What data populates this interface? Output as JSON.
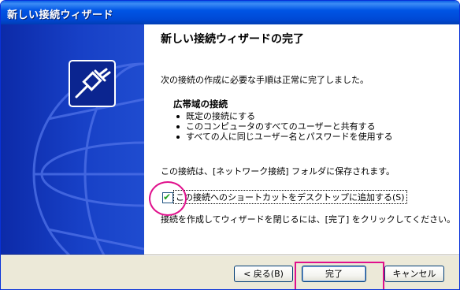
{
  "window": {
    "title": "新しい接続ウィザード"
  },
  "main": {
    "heading": "新しい接続ウィザードの完了",
    "description": "次の接続の作成に必要な手順は正常に完了しました。",
    "summary": {
      "title": "広帯域の接続",
      "items": [
        "既定の接続にする",
        "このコンピュータのすべてのユーザーと共有する",
        "すべての人に同じユーザー名とパスワードを使用する"
      ]
    },
    "saved_note": "この接続は、[ネットワーク接続] フォルダに保存されます。",
    "shortcut_checkbox": {
      "label": "この接続へのショートカットをデスクトップに追加する(S)",
      "checked": true
    },
    "finish_instruction": "接続を作成してウィザードを閉じるには、[完了] をクリックしてください。"
  },
  "buttons": {
    "back": "< 戻る(B)",
    "finish": "完了",
    "cancel": "キャンセル"
  },
  "colors": {
    "titlebar": "#0055E5",
    "sidebar": "#1740C6",
    "highlight": "#E0108C",
    "checkmark": "#21A121"
  }
}
